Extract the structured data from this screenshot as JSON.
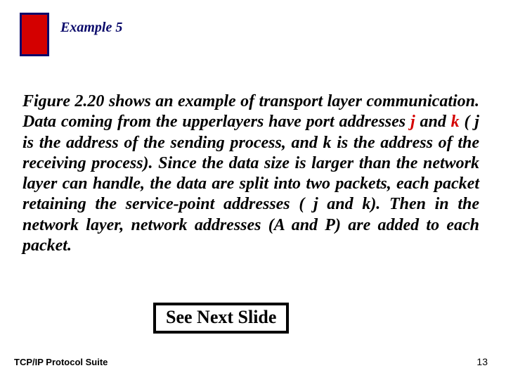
{
  "header": {
    "example_label": "Example 5"
  },
  "body": {
    "p1a": "Figure 2.20 shows an example of transport layer communication. Data coming from the upperlayers have port addresses ",
    "j": "j",
    "p1b": " and ",
    "k": "k",
    "p1c": " ( j is the address of the sending process, and k is the address of the receiving process). Since the data size is larger than the network layer can handle, the data are split into two packets, each packet retaining the service-point addresses ( j and k). Then in the network layer, network addresses (A and P) are added to each packet."
  },
  "see_next": "See Next Slide",
  "footer": {
    "left": "TCP/IP Protocol Suite",
    "right": "13"
  }
}
